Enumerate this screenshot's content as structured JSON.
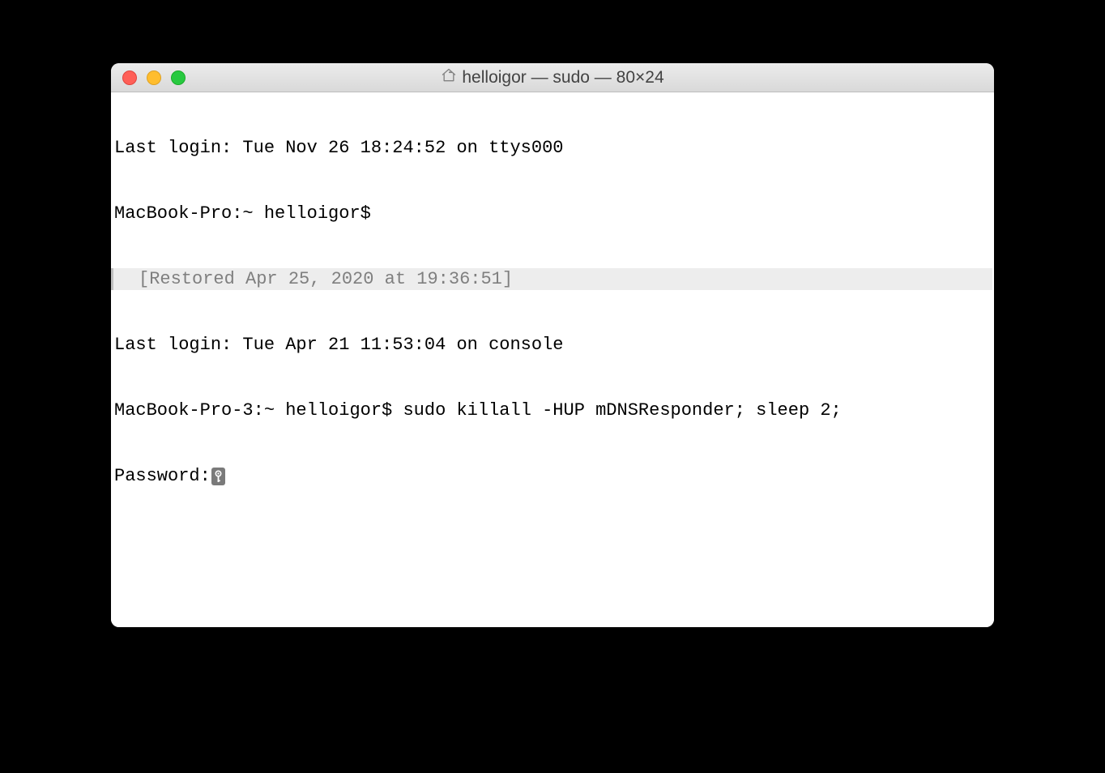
{
  "window": {
    "title": "helloigor — sudo — 80×24"
  },
  "terminal": {
    "line1": "Last login: Tue Nov 26 18:24:52 on ttys000",
    "prompt1": "MacBook-Pro:~ helloigor$ ",
    "restored": "[Restored Apr 25, 2020 at 19:36:51]",
    "line2": "Last login: Tue Apr 21 11:53:04 on console",
    "prompt2": "MacBook-Pro-3:~ helloigor$ ",
    "command": "sudo killall -HUP mDNSResponder; sleep 2;",
    "password_label": "Password:"
  }
}
